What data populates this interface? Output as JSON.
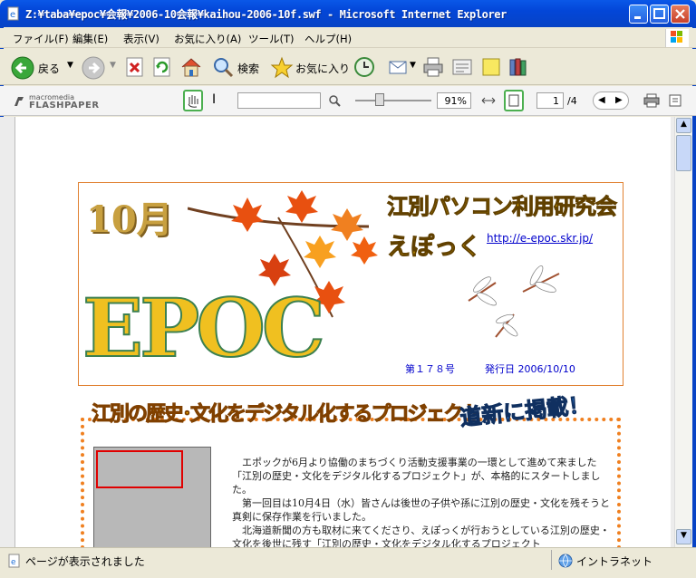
{
  "window": {
    "title": "Z:¥taba¥epoc¥会報¥2006-10会報¥kaihou-2006-10f.swf - Microsoft Internet Explorer"
  },
  "menu": [
    {
      "label": "ファイル(F)"
    },
    {
      "label": "編集(E)"
    },
    {
      "label": "表示(V)"
    },
    {
      "label": "お気に入り(A)"
    },
    {
      "label": "ツール(T)"
    },
    {
      "label": "ヘルプ(H)"
    }
  ],
  "toolbar": {
    "back_label": "戻る",
    "search_label": "検索",
    "favorites_label": "お気に入り"
  },
  "flashpaper": {
    "logo_top": "macromedia",
    "logo_bottom": "FLASHPAPER",
    "search_value": "",
    "zoom": "91%",
    "page_current": "1",
    "page_total": "/4"
  },
  "document": {
    "month": "10月",
    "epoc": "EPOC",
    "club_name": "江別パソコン利用研究会",
    "club_nick": "えぽっく",
    "url": "http://e-epoc.skr.jp/",
    "issue": "第１７８号",
    "issue_date": "発行日 2006/10/10",
    "project_title": "江別の歴史･文化をデジタル化するプロジェクト",
    "banner": "道新に掲載！",
    "paragraphs": [
      "エポックが6月より協働のまちづくり活動支援事業の一環として進めて来ました「江別の歴史・文化をデジタル化するプロジェクト」が、本格的にスタートしました。",
      "第一回目は10月4日（水）皆さんは後世の子供や孫に江別の歴史・文化を残そうと真剣に保存作業を行いました。",
      "北海道新聞の方も取材に来てくださり、えぽっくが行おうとしている江別の歴史・文化を後世に残す「江別の歴史・文化をデジタル化するプロジェクト"
    ]
  },
  "status": {
    "text": "ページが表示されました",
    "zone": "イントラネット"
  },
  "colors": {
    "titlebar": "#0A58E8",
    "accent_orange": "#F08020",
    "link_blue": "#0000CC"
  }
}
